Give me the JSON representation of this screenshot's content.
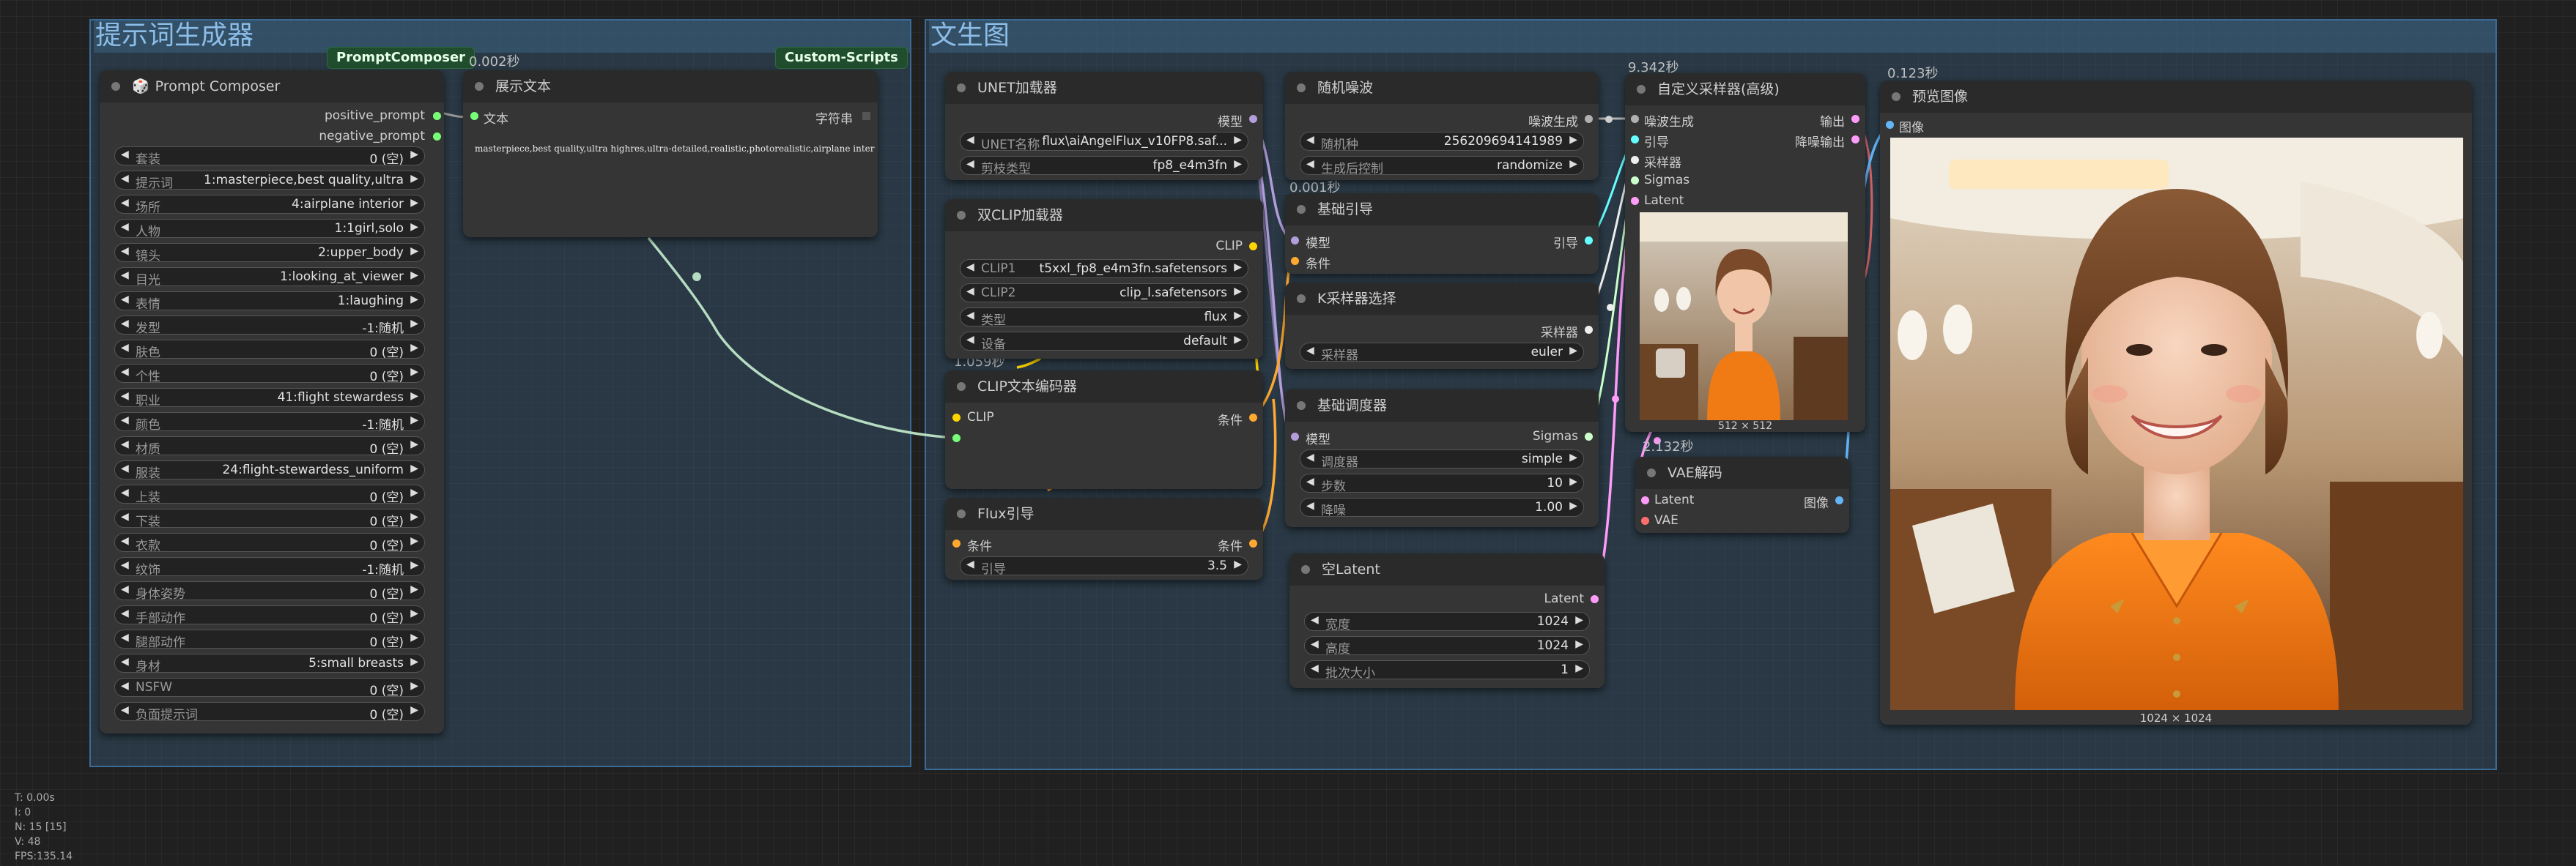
{
  "groups": {
    "prompt_group_title": "提示词生成器",
    "txt2img_group_title": "文生图"
  },
  "badges": {
    "prompt_composer": "PromptComposer",
    "custom_scripts": "Custom-Scripts"
  },
  "timings": {
    "show_text": "0.002秒",
    "clip_loader": "1.059秒",
    "random_noise": "0.001秒",
    "sampler": "9.342秒",
    "vae": "2.132秒",
    "preview": "0.123秒"
  },
  "prompt_composer": {
    "title": "Prompt Composer",
    "outputs": [
      "positive_prompt",
      "negative_prompt"
    ],
    "fields": [
      {
        "label": "套装",
        "value": "0 (空)"
      },
      {
        "label": "提示词",
        "value": "1:masterpiece,best quality,ultra"
      },
      {
        "label": "场所",
        "value": "4:airplane interior"
      },
      {
        "label": "人物",
        "value": "1:1girl,solo"
      },
      {
        "label": "镜头",
        "value": "2:upper_body"
      },
      {
        "label": "目光",
        "value": "1:looking_at_viewer"
      },
      {
        "label": "表情",
        "value": "1:laughing"
      },
      {
        "label": "发型",
        "value": "-1:随机"
      },
      {
        "label": "肤色",
        "value": "0 (空)"
      },
      {
        "label": "个性",
        "value": "0 (空)"
      },
      {
        "label": "职业",
        "value": "41:flight stewardess"
      },
      {
        "label": "颜色",
        "value": "-1:随机"
      },
      {
        "label": "材质",
        "value": "0 (空)"
      },
      {
        "label": "服装",
        "value": "24:flight-stewardess_uniform"
      },
      {
        "label": "上装",
        "value": "0 (空)"
      },
      {
        "label": "下装",
        "value": "0 (空)"
      },
      {
        "label": "衣款",
        "value": "0 (空)"
      },
      {
        "label": "纹饰",
        "value": "-1:随机"
      },
      {
        "label": "身体姿势",
        "value": "0 (空)"
      },
      {
        "label": "手部动作",
        "value": "0 (空)"
      },
      {
        "label": "腿部动作",
        "value": "0 (空)"
      },
      {
        "label": "身材",
        "value": "5:small breasts"
      },
      {
        "label": "NSFW",
        "value": "0 (空)"
      },
      {
        "label": "负面提示词",
        "value": "0 (空)"
      }
    ]
  },
  "show_text": {
    "title": "展示文本",
    "input": "文本",
    "output": "字符串",
    "content": "masterpiece,best quality,ultra highres,ultra-detailed,realistic,photorealistic,airplane inter"
  },
  "unet": {
    "title": "UNET加载器",
    "output": "模型",
    "fields": [
      {
        "label": "UNET名称",
        "value": "flux\\aiAngelFlux_v10FP8.saf..."
      },
      {
        "label": "剪枝类型",
        "value": "fp8_e4m3fn"
      }
    ]
  },
  "dual_clip": {
    "title": "双CLIP加载器",
    "output": "CLIP",
    "fields": [
      {
        "label": "CLIP1",
        "value": "t5xxl_fp8_e4m3fn.safetensors"
      },
      {
        "label": "CLIP2",
        "value": "clip_l.safetensors"
      },
      {
        "label": "类型",
        "value": "flux"
      },
      {
        "label": "设备",
        "value": "default"
      }
    ]
  },
  "clip_encode": {
    "title": "CLIP文本编码器",
    "input": "CLIP",
    "output": "条件"
  },
  "flux_guide": {
    "title": "Flux引导",
    "input": "条件",
    "output": "条件",
    "fields": [
      {
        "label": "引导",
        "value": "3.5"
      }
    ]
  },
  "random_noise": {
    "title": "随机噪波",
    "output": "噪波生成",
    "fields": [
      {
        "label": "随机种",
        "value": "256209694141989"
      },
      {
        "label": "生成后控制",
        "value": "randomize"
      }
    ]
  },
  "basic_guider": {
    "title": "基础引导",
    "inputs": [
      "模型",
      "条件"
    ],
    "output": "引导"
  },
  "ksampler_select": {
    "title": "K采样器选择",
    "output": "采样器",
    "fields": [
      {
        "label": "采样器",
        "value": "euler"
      }
    ]
  },
  "basic_scheduler": {
    "title": "基础调度器",
    "input": "模型",
    "output": "Sigmas",
    "fields": [
      {
        "label": "调度器",
        "value": "simple"
      },
      {
        "label": "步数",
        "value": "10"
      },
      {
        "label": "降噪",
        "value": "1.00"
      }
    ]
  },
  "empty_latent": {
    "title": "空Latent",
    "output": "Latent",
    "fields": [
      {
        "label": "宽度",
        "value": "1024"
      },
      {
        "label": "高度",
        "value": "1024"
      },
      {
        "label": "批次大小",
        "value": "1"
      }
    ]
  },
  "sampler": {
    "title": "自定义采样器(高级)",
    "inputs": [
      "噪波生成",
      "引导",
      "采样器",
      "Sigmas",
      "Latent"
    ],
    "outputs": [
      "输出",
      "降噪输出"
    ],
    "thumb_size": "512 × 512"
  },
  "vae_decode": {
    "title": "VAE解码",
    "inputs": [
      "Latent",
      "VAE"
    ],
    "output": "图像"
  },
  "preview": {
    "title": "预览图像",
    "input": "图像",
    "image_size": "1024 × 1024"
  },
  "stats": [
    "T: 0.00s",
    "I: 0",
    "N: 15 [15]",
    "V: 48",
    "FPS:135.14"
  ],
  "colors": {
    "model": "#b39ddb",
    "clip": "#ffd500",
    "conditioning": "#ffa931",
    "latent": "#ff9cf9",
    "sigmas": "#cdffcd",
    "noise": "#b0b0b0",
    "guider": "#66ffff",
    "image": "#64b5f6",
    "vae": "#ff6e6e",
    "string": "#77ff77"
  }
}
